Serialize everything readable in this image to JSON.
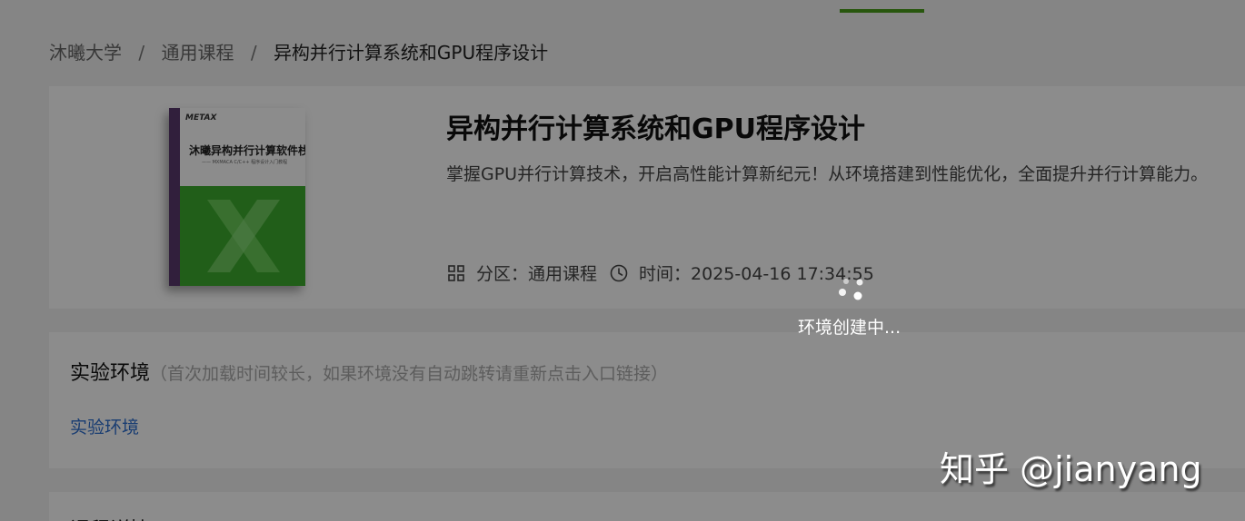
{
  "breadcrumb": {
    "items": [
      "沐曦大学",
      "通用课程",
      "异构并行计算系统和GPU程序设计"
    ],
    "separator": "/"
  },
  "course": {
    "title": "异构并行计算系统和GPU程序设计",
    "description": "掌握GPU并行计算技术，开启高性能计算新纪元！从环境搭建到性能优化，全面提升并行计算能力。",
    "category_label": "分区：通用课程",
    "time_label": "时间：2025-04-16 17:34:55",
    "cover": {
      "logo": "METAX",
      "book_title": "沐曦异构并行计算软件栈",
      "book_subtitle": "—— MXMACA C/C++ 程序设计入门教程",
      "icons": [
        "grid-icon",
        "clock-icon"
      ]
    }
  },
  "environment": {
    "title": "实验环境",
    "note": "（首次加载时间较长，如果环境没有自动跳转请重新点击入口链接）",
    "link": "实验环境"
  },
  "next_section": {
    "title": "课程详情"
  },
  "overlay": {
    "loading_text": "环境创建中...",
    "watermark": "知乎 @jianyang"
  },
  "colors": {
    "accent": "#4a9d1a",
    "link": "#2f6fd0",
    "overlay": "rgba(0,0,0,0.45)",
    "cover_green": "#3cab2e",
    "cover_spine": "#5a3a6e"
  }
}
